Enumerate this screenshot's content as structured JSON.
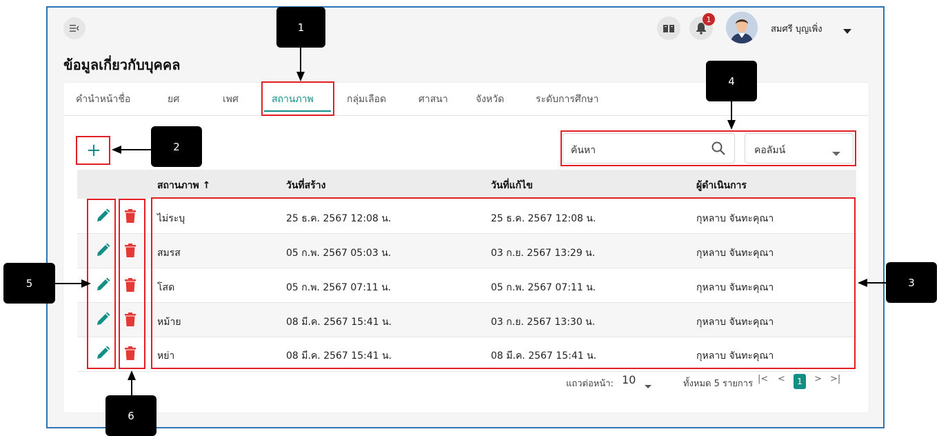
{
  "header": {
    "menu_icon": "menu-collapse-icon",
    "manual_icon": "book-icon",
    "bell_icon": "bell-icon",
    "notification_count": "1",
    "user_name": "สมศรี บุญเพิ่ง",
    "user_dropdown_icon": "caret-down-icon"
  },
  "page": {
    "title": "ข้อมูลเกี่ยวกับบุคคล"
  },
  "tabs": [
    {
      "label": "คำนำหน้าชื่อ",
      "active": false
    },
    {
      "label": "ยศ",
      "active": false
    },
    {
      "label": "เพศ",
      "active": false
    },
    {
      "label": "สถานภาพ",
      "active": true
    },
    {
      "label": "กลุ่มเลือด",
      "active": false
    },
    {
      "label": "ศาสนา",
      "active": false
    },
    {
      "label": "จังหวัด",
      "active": false
    },
    {
      "label": "ระดับการศึกษา",
      "active": false
    }
  ],
  "toolbar": {
    "add_label": "+",
    "search_placeholder": "ค้นหา",
    "column_select": "คอลัมน์"
  },
  "table": {
    "columns": [
      "สถานภาพ ↑",
      "วันที่สร้าง",
      "วันที่แก้ไข",
      "ผู้ดำเนินการ"
    ],
    "rows": [
      [
        "ไม่ระบุ",
        "25 ธ.ค. 2567 12:08 น.",
        "25 ธ.ค. 2567 12:08 น.",
        "กุหลาบ จันทะคุณา"
      ],
      [
        "สมรส",
        "05 ก.พ. 2567 05:03 น.",
        "03 ก.ย. 2567 13:29 น.",
        "กุหลาบ จันทะคุณา"
      ],
      [
        "โสด",
        "05 ก.พ. 2567 07:11 น.",
        "05 ก.พ. 2567 07:11 น.",
        "กุหลาบ จันทะคุณา"
      ],
      [
        "หม้าย",
        "08 มี.ค. 2567 15:41 น.",
        "03 ก.ย. 2567 13:30 น.",
        "กุหลาบ จันทะคุณา"
      ],
      [
        "หย่า",
        "08 มี.ค. 2567 15:41 น.",
        "08 มี.ค. 2567 15:41 น.",
        "กุหลาบ จันทะคุณา"
      ]
    ],
    "edit_icon": "pencil-icon",
    "delete_icon": "trash-icon"
  },
  "pagination": {
    "rows_per_page_label": "แถวต่อหน้า:",
    "rows_per_page": "10",
    "total": "ทั้งหมด 5 รายการ",
    "first": "|<",
    "prev": "<",
    "current": "1",
    "next": ">",
    "last": ">|"
  },
  "callouts": [
    "1",
    "2",
    "3",
    "4",
    "5",
    "6"
  ],
  "colors": {
    "accent": "#148f86",
    "annotation_red": "#e31e24",
    "delete_red": "#e53935",
    "frame_blue": "#2e75b6"
  }
}
